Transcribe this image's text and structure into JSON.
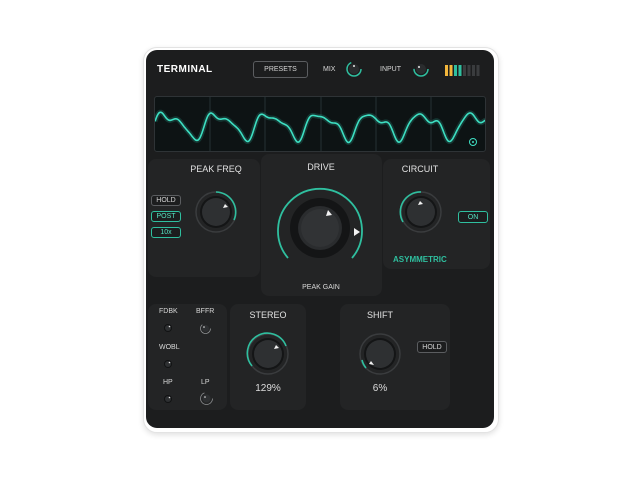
{
  "header": {
    "title": "TERMINAL",
    "presets_label": "PRESETS",
    "mix_label": "MIX",
    "input_label": "INPUT"
  },
  "peak_freq": {
    "title": "PEAK FREQ",
    "hold_label": "HOLD",
    "post_label": "POST",
    "multiplier_label": "10x"
  },
  "drive": {
    "title": "DRIVE",
    "sub_label": "PEAK GAIN"
  },
  "circuit": {
    "title": "CIRCUIT",
    "on_label": "ON",
    "mode_label": "ASYMMETRIC"
  },
  "mods": {
    "fdbk_label": "FDBK",
    "bffr_label": "BFFR",
    "wobl_label": "WOBL",
    "hp_label": "HP",
    "lp_label": "LP"
  },
  "stereo": {
    "title": "STEREO",
    "value": "129%"
  },
  "shift": {
    "title": "SHIFT",
    "value": "6%",
    "hold_label": "HOLD"
  },
  "colors": {
    "accent": "#2fbf9f",
    "waveform": "#3ee0c3",
    "background": "#1c1d1e",
    "panel": "#232425"
  }
}
